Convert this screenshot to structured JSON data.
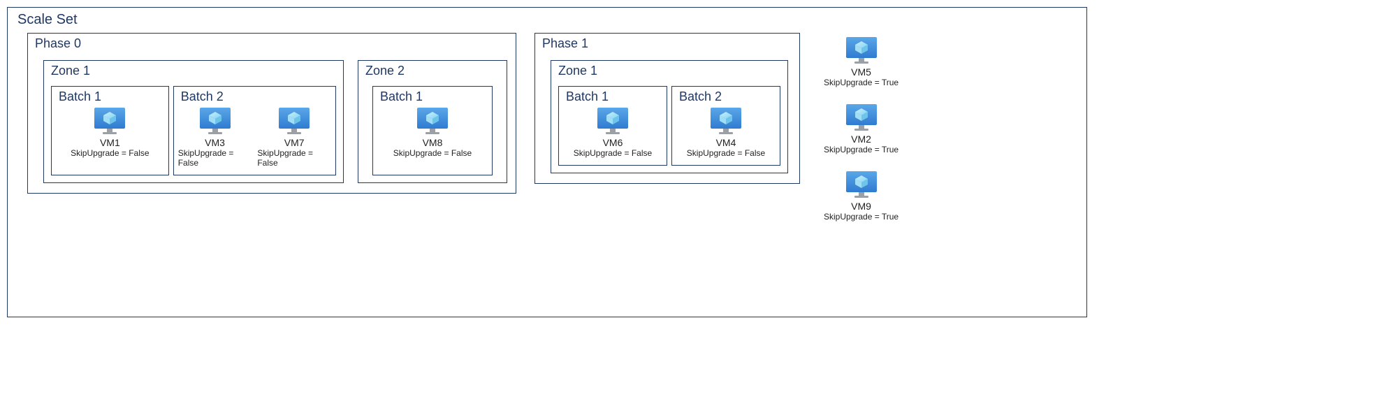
{
  "scaleSet": {
    "title": "Scale Set"
  },
  "phases": [
    {
      "title": "Phase 0",
      "zones": [
        {
          "title": "Zone 1",
          "batches": [
            {
              "title": "Batch 1",
              "vms": [
                {
                  "name": "VM1",
                  "skip": "SkipUpgrade = False"
                }
              ]
            },
            {
              "title": "Batch 2",
              "vms": [
                {
                  "name": "VM3",
                  "skip": "SkipUpgrade = False"
                },
                {
                  "name": "VM7",
                  "skip": "SkipUpgrade = False"
                }
              ]
            }
          ]
        },
        {
          "title": "Zone 2",
          "batches": [
            {
              "title": "Batch 1",
              "vms": [
                {
                  "name": "VM8",
                  "skip": "SkipUpgrade = False"
                }
              ]
            }
          ]
        }
      ]
    },
    {
      "title": "Phase 1",
      "zones": [
        {
          "title": "Zone 1",
          "batches": [
            {
              "title": "Batch 1",
              "vms": [
                {
                  "name": "VM6",
                  "skip": "SkipUpgrade = False"
                }
              ]
            },
            {
              "title": "Batch 2",
              "vms": [
                {
                  "name": "VM4",
                  "skip": "SkipUpgrade = False"
                }
              ]
            }
          ]
        }
      ]
    }
  ],
  "sideVms": [
    {
      "name": "VM5",
      "skip": "SkipUpgrade = True"
    },
    {
      "name": "VM2",
      "skip": "SkipUpgrade = True"
    },
    {
      "name": "VM9",
      "skip": "SkipUpgrade = True"
    }
  ]
}
